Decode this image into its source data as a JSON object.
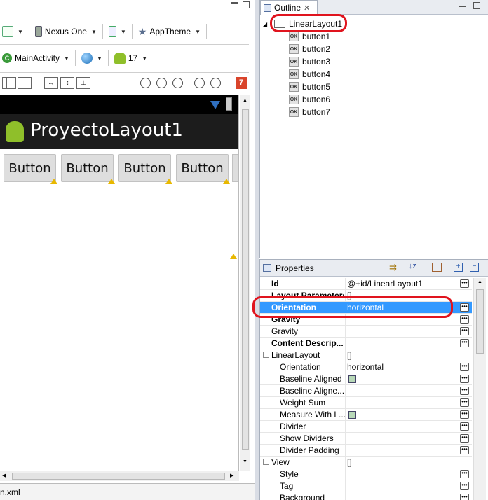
{
  "toolbar": {
    "device_label": "Nexus One",
    "theme_label": "AppTheme",
    "activity_label": "MainActivity",
    "api_label": "17",
    "error_badge": "7"
  },
  "preview": {
    "app_title": "ProyectoLayout1",
    "buttons": [
      "Button",
      "Button",
      "Button",
      "Button"
    ]
  },
  "bottom_tab": {
    "label": "n.xml"
  },
  "outline": {
    "tab_label": "Outline",
    "root": "LinearLayout1",
    "children": [
      "button1",
      "button2",
      "button3",
      "button4",
      "button5",
      "button6",
      "button7"
    ]
  },
  "properties": {
    "tab_label": "Properties",
    "rows": [
      {
        "name": "Id",
        "value": "@+id/LinearLayout1",
        "bold": true
      },
      {
        "name": "Layout Parameters",
        "value": "[]",
        "bold": true
      },
      {
        "name": "Orientation",
        "value": "horizontal",
        "bold": true,
        "selected": true
      },
      {
        "name": "Gravity",
        "value": "",
        "bold": true
      },
      {
        "name": "Gravity",
        "value": ""
      },
      {
        "name": "Content Descrip...",
        "value": "",
        "bold": true
      },
      {
        "name": "LinearLayout",
        "value": "[]",
        "group": true
      },
      {
        "name": "Orientation",
        "value": "horizontal",
        "indent": true
      },
      {
        "name": "Baseline Aligned",
        "value": "",
        "checkbox": true,
        "indent": true
      },
      {
        "name": "Baseline Aligne...",
        "value": "",
        "indent": true
      },
      {
        "name": "Weight Sum",
        "value": "",
        "indent": true
      },
      {
        "name": "Measure With L...",
        "value": "",
        "checkbox": true,
        "indent": true
      },
      {
        "name": "Divider",
        "value": "",
        "indent": true
      },
      {
        "name": "Show Dividers",
        "value": "",
        "indent": true
      },
      {
        "name": "Divider Padding",
        "value": "",
        "indent": true
      },
      {
        "name": "View",
        "value": "[]",
        "group": true
      },
      {
        "name": "Style",
        "value": "",
        "indent": true
      },
      {
        "name": "Tag",
        "value": "",
        "indent": true
      },
      {
        "name": "Background",
        "value": "",
        "indent": true
      }
    ]
  },
  "colors": {
    "selection": "#3399ff",
    "highlight_mark": "#e0141e",
    "warning": "#e8b800"
  }
}
